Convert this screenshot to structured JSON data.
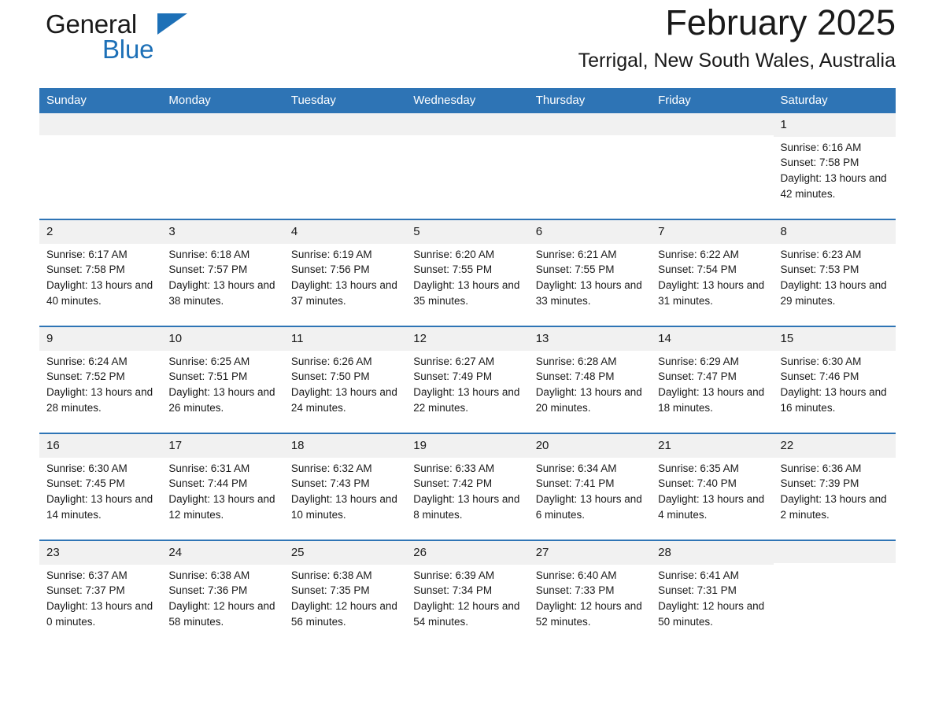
{
  "brand": {
    "word1": "General",
    "word2": "Blue",
    "triangle_color": "#1d70b7",
    "logo_name": "general-blue-logo"
  },
  "header": {
    "title": "February 2025",
    "subtitle": "Terrigal, New South Wales, Australia",
    "accent_color": "#2e74b5",
    "day_band_color": "#f1f1f1"
  },
  "weekdays": [
    "Sunday",
    "Monday",
    "Tuesday",
    "Wednesday",
    "Thursday",
    "Friday",
    "Saturday"
  ],
  "labels": {
    "sunrise": "Sunrise:",
    "sunset": "Sunset:",
    "daylight": "Daylight:"
  },
  "weeks": [
    [
      {
        "day": "",
        "empty": true
      },
      {
        "day": "",
        "empty": true
      },
      {
        "day": "",
        "empty": true
      },
      {
        "day": "",
        "empty": true
      },
      {
        "day": "",
        "empty": true
      },
      {
        "day": "",
        "empty": true
      },
      {
        "day": "1",
        "sunrise": "Sunrise: 6:16 AM",
        "sunset": "Sunset: 7:58 PM",
        "daylight": "Daylight: 13 hours and 42 minutes."
      }
    ],
    [
      {
        "day": "2",
        "sunrise": "Sunrise: 6:17 AM",
        "sunset": "Sunset: 7:58 PM",
        "daylight": "Daylight: 13 hours and 40 minutes."
      },
      {
        "day": "3",
        "sunrise": "Sunrise: 6:18 AM",
        "sunset": "Sunset: 7:57 PM",
        "daylight": "Daylight: 13 hours and 38 minutes."
      },
      {
        "day": "4",
        "sunrise": "Sunrise: 6:19 AM",
        "sunset": "Sunset: 7:56 PM",
        "daylight": "Daylight: 13 hours and 37 minutes."
      },
      {
        "day": "5",
        "sunrise": "Sunrise: 6:20 AM",
        "sunset": "Sunset: 7:55 PM",
        "daylight": "Daylight: 13 hours and 35 minutes."
      },
      {
        "day": "6",
        "sunrise": "Sunrise: 6:21 AM",
        "sunset": "Sunset: 7:55 PM",
        "daylight": "Daylight: 13 hours and 33 minutes."
      },
      {
        "day": "7",
        "sunrise": "Sunrise: 6:22 AM",
        "sunset": "Sunset: 7:54 PM",
        "daylight": "Daylight: 13 hours and 31 minutes."
      },
      {
        "day": "8",
        "sunrise": "Sunrise: 6:23 AM",
        "sunset": "Sunset: 7:53 PM",
        "daylight": "Daylight: 13 hours and 29 minutes."
      }
    ],
    [
      {
        "day": "9",
        "sunrise": "Sunrise: 6:24 AM",
        "sunset": "Sunset: 7:52 PM",
        "daylight": "Daylight: 13 hours and 28 minutes."
      },
      {
        "day": "10",
        "sunrise": "Sunrise: 6:25 AM",
        "sunset": "Sunset: 7:51 PM",
        "daylight": "Daylight: 13 hours and 26 minutes."
      },
      {
        "day": "11",
        "sunrise": "Sunrise: 6:26 AM",
        "sunset": "Sunset: 7:50 PM",
        "daylight": "Daylight: 13 hours and 24 minutes."
      },
      {
        "day": "12",
        "sunrise": "Sunrise: 6:27 AM",
        "sunset": "Sunset: 7:49 PM",
        "daylight": "Daylight: 13 hours and 22 minutes."
      },
      {
        "day": "13",
        "sunrise": "Sunrise: 6:28 AM",
        "sunset": "Sunset: 7:48 PM",
        "daylight": "Daylight: 13 hours and 20 minutes."
      },
      {
        "day": "14",
        "sunrise": "Sunrise: 6:29 AM",
        "sunset": "Sunset: 7:47 PM",
        "daylight": "Daylight: 13 hours and 18 minutes."
      },
      {
        "day": "15",
        "sunrise": "Sunrise: 6:30 AM",
        "sunset": "Sunset: 7:46 PM",
        "daylight": "Daylight: 13 hours and 16 minutes."
      }
    ],
    [
      {
        "day": "16",
        "sunrise": "Sunrise: 6:30 AM",
        "sunset": "Sunset: 7:45 PM",
        "daylight": "Daylight: 13 hours and 14 minutes."
      },
      {
        "day": "17",
        "sunrise": "Sunrise: 6:31 AM",
        "sunset": "Sunset: 7:44 PM",
        "daylight": "Daylight: 13 hours and 12 minutes."
      },
      {
        "day": "18",
        "sunrise": "Sunrise: 6:32 AM",
        "sunset": "Sunset: 7:43 PM",
        "daylight": "Daylight: 13 hours and 10 minutes."
      },
      {
        "day": "19",
        "sunrise": "Sunrise: 6:33 AM",
        "sunset": "Sunset: 7:42 PM",
        "daylight": "Daylight: 13 hours and 8 minutes."
      },
      {
        "day": "20",
        "sunrise": "Sunrise: 6:34 AM",
        "sunset": "Sunset: 7:41 PM",
        "daylight": "Daylight: 13 hours and 6 minutes."
      },
      {
        "day": "21",
        "sunrise": "Sunrise: 6:35 AM",
        "sunset": "Sunset: 7:40 PM",
        "daylight": "Daylight: 13 hours and 4 minutes."
      },
      {
        "day": "22",
        "sunrise": "Sunrise: 6:36 AM",
        "sunset": "Sunset: 7:39 PM",
        "daylight": "Daylight: 13 hours and 2 minutes."
      }
    ],
    [
      {
        "day": "23",
        "sunrise": "Sunrise: 6:37 AM",
        "sunset": "Sunset: 7:37 PM",
        "daylight": "Daylight: 13 hours and 0 minutes."
      },
      {
        "day": "24",
        "sunrise": "Sunrise: 6:38 AM",
        "sunset": "Sunset: 7:36 PM",
        "daylight": "Daylight: 12 hours and 58 minutes."
      },
      {
        "day": "25",
        "sunrise": "Sunrise: 6:38 AM",
        "sunset": "Sunset: 7:35 PM",
        "daylight": "Daylight: 12 hours and 56 minutes."
      },
      {
        "day": "26",
        "sunrise": "Sunrise: 6:39 AM",
        "sunset": "Sunset: 7:34 PM",
        "daylight": "Daylight: 12 hours and 54 minutes."
      },
      {
        "day": "27",
        "sunrise": "Sunrise: 6:40 AM",
        "sunset": "Sunset: 7:33 PM",
        "daylight": "Daylight: 12 hours and 52 minutes."
      },
      {
        "day": "28",
        "sunrise": "Sunrise: 6:41 AM",
        "sunset": "Sunset: 7:31 PM",
        "daylight": "Daylight: 12 hours and 50 minutes."
      },
      {
        "day": "",
        "empty": true
      }
    ]
  ]
}
